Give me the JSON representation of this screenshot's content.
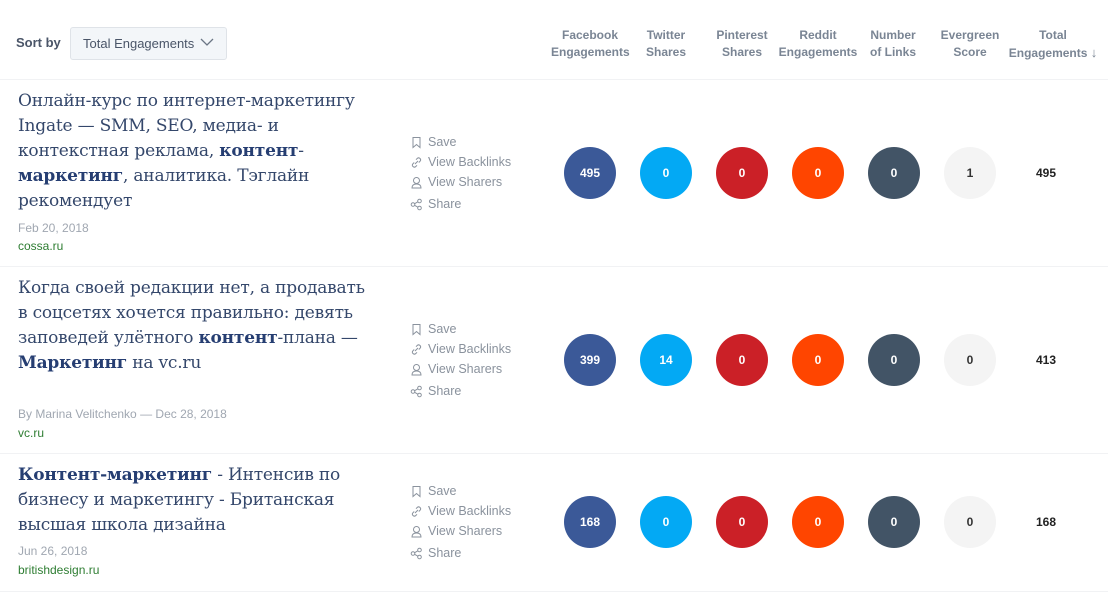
{
  "sort": {
    "label": "Sort by",
    "selected": "Total Engagements"
  },
  "columns": [
    {
      "line1": "Facebook",
      "line2": "Engagements"
    },
    {
      "line1": "Twitter",
      "line2": "Shares"
    },
    {
      "line1": "Pinterest",
      "line2": "Shares"
    },
    {
      "line1": "Reddit",
      "line2": "Engagements"
    },
    {
      "line1": "Number",
      "line2": "of Links"
    },
    {
      "line1": "Evergreen",
      "line2": "Score"
    },
    {
      "line1": "Total",
      "line2": "Engagements",
      "sort_arrow": "↓"
    }
  ],
  "actions": {
    "save": "Save",
    "backlinks": "View Backlinks",
    "sharers": "View Sharers",
    "share": "Share"
  },
  "colors": {
    "facebook": "#3b5998",
    "twitter": "#03a9f4",
    "pinterest": "#cb2027",
    "reddit": "#ff4500",
    "links": "#425466",
    "evergreen": "#f4f4f4"
  },
  "rows": [
    {
      "title_parts": [
        {
          "text": "Онлайн-курс по интернет-маркетингу Ingate — SMM, SEO, медиа- и контекстная реклама, ",
          "bold": false
        },
        {
          "text": "контент",
          "bold": true
        },
        {
          "text": "-",
          "bold": false
        },
        {
          "text": "маркетинг",
          "bold": true
        },
        {
          "text": ", аналитика. Тэглайн рекомендует",
          "bold": false
        }
      ],
      "meta": "Feb 20, 2018",
      "domain": "cossa.ru",
      "facebook": "495",
      "twitter": "0",
      "pinterest": "0",
      "reddit": "0",
      "links": "0",
      "evergreen": "1",
      "total": "495"
    },
    {
      "title_parts": [
        {
          "text": "Когда своей редакции нет, а продавать в соцсетях хочется правильно: девять заповедей улётного ",
          "bold": false
        },
        {
          "text": "контент",
          "bold": true
        },
        {
          "text": "-плана — ",
          "bold": false
        },
        {
          "text": "Маркетинг",
          "bold": true
        },
        {
          "text": " на vc.ru",
          "bold": false
        }
      ],
      "meta": "By Marina Velitchenko — Dec 28, 2018",
      "domain": "vc.ru",
      "facebook": "399",
      "twitter": "14",
      "pinterest": "0",
      "reddit": "0",
      "links": "0",
      "evergreen": "0",
      "total": "413"
    },
    {
      "title_parts": [
        {
          "text": "Контент-маркетинг",
          "bold": true
        },
        {
          "text": " - Интенсив по бизнесу и маркетингу - Британская высшая школа дизайна",
          "bold": false
        }
      ],
      "meta": "Jun 26, 2018",
      "domain": "britishdesign.ru",
      "facebook": "168",
      "twitter": "0",
      "pinterest": "0",
      "reddit": "0",
      "links": "0",
      "evergreen": "0",
      "total": "168"
    }
  ]
}
